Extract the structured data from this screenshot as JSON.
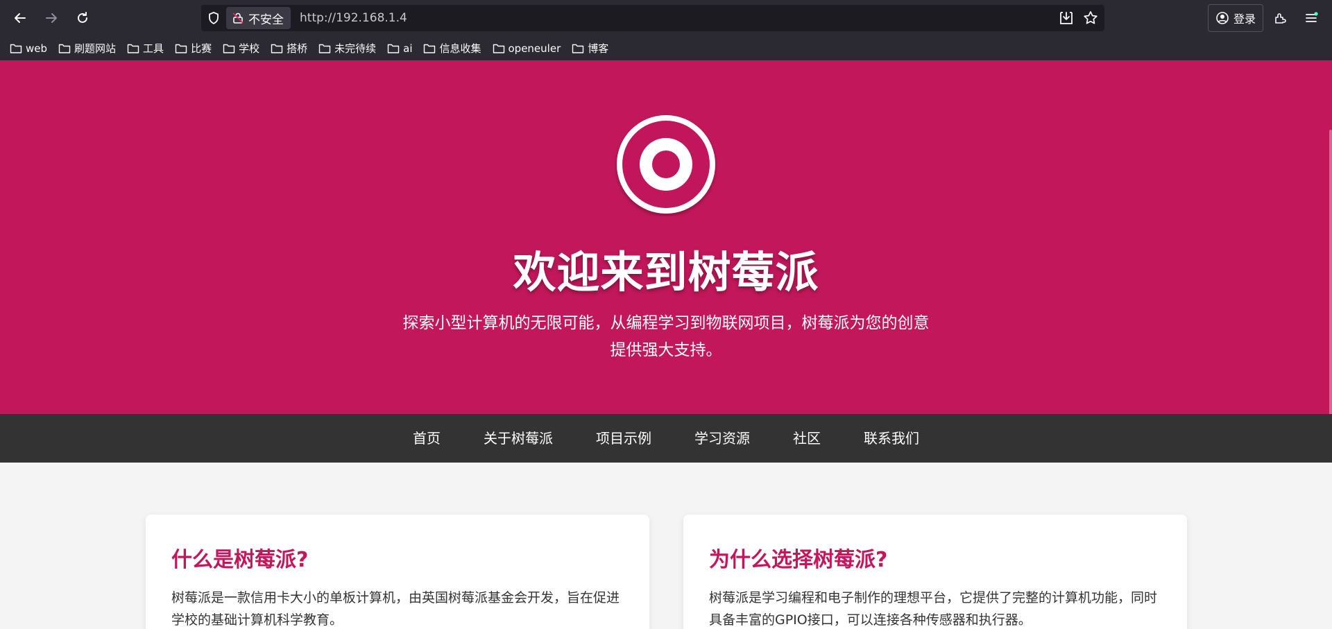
{
  "browser": {
    "security_label": "不安全",
    "url": "http://192.168.1.4",
    "login_label": "登录",
    "bookmarks": [
      {
        "label": "web"
      },
      {
        "label": "刷题网站"
      },
      {
        "label": "工具"
      },
      {
        "label": "比赛"
      },
      {
        "label": "学校"
      },
      {
        "label": "搭桥"
      },
      {
        "label": "未完待续"
      },
      {
        "label": "ai"
      },
      {
        "label": "信息收集"
      },
      {
        "label": "openeuler"
      },
      {
        "label": "博客"
      }
    ],
    "icons": [
      "back-icon",
      "forward-icon",
      "reload-icon",
      "shield-icon",
      "lock-icon",
      "download-icon",
      "star-icon",
      "account-icon",
      "extensions-icon",
      "menu-icon",
      "folder-icon"
    ]
  },
  "hero": {
    "title": "欢迎来到树莓派",
    "subtitle": "探索小型计算机的无限可能，从编程学习到物联网项目，树莓派为您的创意提供强大支持。"
  },
  "nav": {
    "items": [
      {
        "label": "首页"
      },
      {
        "label": "关于树莓派"
      },
      {
        "label": "项目示例"
      },
      {
        "label": "学习资源"
      },
      {
        "label": "社区"
      },
      {
        "label": "联系我们"
      }
    ]
  },
  "cards": [
    {
      "title": "什么是树莓派?",
      "text": "树莓派是一款信用卡大小的单板计算机，由英国树莓派基金会开发，旨在促进学校的基础计算机科学教育。"
    },
    {
      "title": "为什么选择树莓派?",
      "text": "树莓派是学习编程和电子制作的理想平台，它提供了完整的计算机功能，同时具备丰富的GPIO接口，可以连接各种传感器和执行器。"
    }
  ],
  "colors": {
    "brand": "#c2185b",
    "nav_bg": "#333333",
    "page_bg": "#f4f4f4",
    "chrome_bg": "#2b2a33"
  }
}
